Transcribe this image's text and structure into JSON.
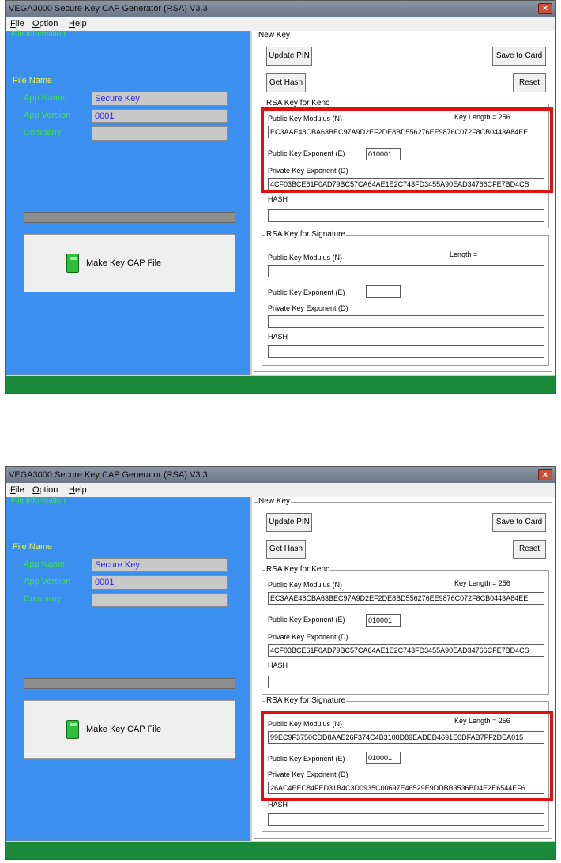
{
  "screens": [
    {
      "title": "VEGA3000 Secure Key CAP Generator (RSA) V3.3",
      "menu": [
        "File",
        "Option",
        "Help"
      ],
      "menu_underline": [
        "F",
        "O",
        "H"
      ],
      "file_info": {
        "legend": "File Information",
        "file_name": "File Name",
        "app_name_label": "App Name",
        "app_name_value": "Secure Key",
        "app_version_label": "App Version",
        "app_version_value": "0001",
        "company_label": "Company",
        "company_value": ""
      },
      "make_button": "Make Key CAP File",
      "new_key": {
        "legend": "New Key",
        "update_pin": "Update PIN",
        "save_to_card": "Save to Card",
        "get_hash": "Get Hash",
        "reset": "Reset"
      },
      "kenc": {
        "legend": "RSA Key for Kenc",
        "modulus_label": "Public Key Modulus (N)",
        "key_length": "Key Length = 256",
        "modulus_value": "EC3AAE48CBA63BEC97A9D2EF2DE8BD556276EE9876C072F8CB0443A84EE",
        "exponent_label": "Public Key Exponent (E)",
        "exponent_value": "010001",
        "private_label": "Private Key Exponent (D)",
        "private_value": "4CF03BCE61F0AD79BC57CA64AE1E2C743FD3455A90EAD34766CFE7BD4CS",
        "hash_label": "HASH",
        "hash_value": ""
      },
      "sig": {
        "legend": "RSA Key for Signature",
        "modulus_label": "Public Key Modulus (N)",
        "key_length": "Length =",
        "modulus_value": "",
        "exponent_label": "Public Key Exponent (E)",
        "exponent_value": "",
        "private_label": "Private Key Exponent (D)",
        "private_value": "",
        "hash_label": "HASH",
        "hash_value": ""
      }
    },
    {
      "title": "VEGA3000 Secure Key CAP Generator (RSA) V3.3",
      "menu": [
        "File",
        "Option",
        "Help"
      ],
      "menu_underline": [
        "F",
        "O",
        "H"
      ],
      "file_info": {
        "legend": "File Information",
        "file_name": "File Name",
        "app_name_label": "App Name",
        "app_name_value": "Secure Key",
        "app_version_label": "App Version",
        "app_version_value": "0001",
        "company_label": "Company",
        "company_value": ""
      },
      "make_button": "Make Key CAP File",
      "new_key": {
        "legend": "New Key",
        "update_pin": "Update PIN",
        "save_to_card": "Save to Card",
        "get_hash": "Get Hash",
        "reset": "Reset"
      },
      "kenc": {
        "legend": "RSA Key for Kenc",
        "modulus_label": "Public Key Modulus (N)",
        "key_length": "Key Length = 256",
        "modulus_value": "EC3AAE48CBA63BEC97A9D2EF2DE8BD556276EE9876C072F8CB0443A84EE",
        "exponent_label": "Public Key Exponent (E)",
        "exponent_value": "010001",
        "private_label": "Private Key Exponent (D)",
        "private_value": "4CF03BCE61F0AD79BC57CA64AE1E2C743FD3455A90EAD34766CFE7BD4CS",
        "hash_label": "HASH",
        "hash_value": ""
      },
      "sig": {
        "legend": "RSA Key for Signature",
        "modulus_label": "Public Key Modulus (N)",
        "key_length": "Key Length = 256",
        "modulus_value": "99EC9F3750CDD8AAE26F374C4B3108D89EADED4691E0DFAB7FF2DEA015",
        "exponent_label": "Public Key Exponent (E)",
        "exponent_value": "010001",
        "private_label": "Private Key Exponent (D)",
        "private_value": "26AC4EEC84FED31B4C3D0935C00697E46529E9DDBB3536BD4E2E6544EF6",
        "hash_label": "HASH",
        "hash_value": ""
      }
    }
  ]
}
